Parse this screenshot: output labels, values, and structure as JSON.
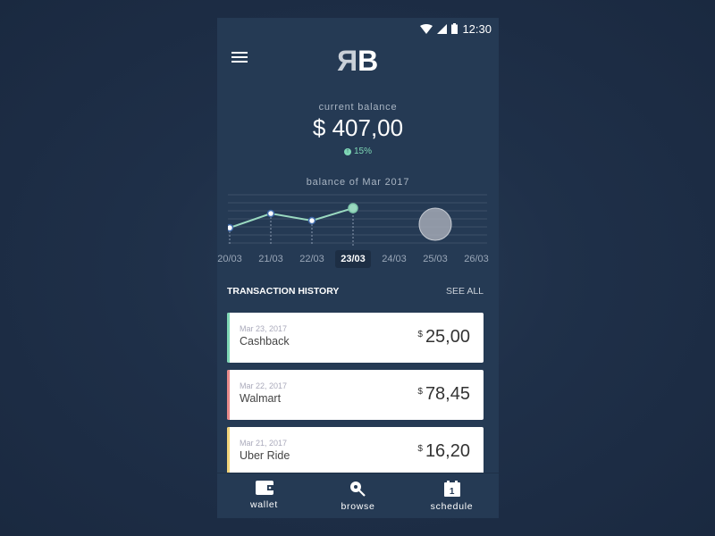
{
  "status_bar": {
    "time": "12:30",
    "icons": [
      "wifi-icon",
      "signal-icon",
      "battery-icon"
    ]
  },
  "header": {
    "logo_left": "R",
    "logo_right": "B",
    "menu_icon": "hamburger-menu-icon"
  },
  "balance": {
    "label": "current balance",
    "value": "$ 407,00",
    "change": "15%",
    "change_direction": "up"
  },
  "chart_data": {
    "type": "line",
    "title": "balance of Mar 2017",
    "categories": [
      "20/03",
      "21/03",
      "22/03",
      "23/03",
      "24/03",
      "25/03",
      "26/03"
    ],
    "values": [
      2,
      3.6,
      2.8,
      4.2,
      null,
      null,
      null
    ],
    "selected": "23/03",
    "gridlines": 7,
    "ylim": [
      0,
      6
    ],
    "highlight_circle_at": "25/03"
  },
  "transactions": {
    "title": "TRANSACTION HISTORY",
    "see_all": "SEE ALL",
    "items": [
      {
        "date": "Mar 23, 2017",
        "name": "Cashback",
        "currency": "$",
        "amount": "25,00",
        "color": "#7ed7b5"
      },
      {
        "date": "Mar 22, 2017",
        "name": "Walmart",
        "currency": "$",
        "amount": "78,45",
        "color": "#e88a8a"
      },
      {
        "date": "Mar 21, 2017",
        "name": "Uber Ride",
        "currency": "$",
        "amount": "16,20",
        "color": "#f2d47a"
      }
    ]
  },
  "nav": [
    {
      "label": "wallet",
      "icon": "wallet-icon"
    },
    {
      "label": "browse",
      "icon": "search-icon"
    },
    {
      "label": "schedule",
      "icon": "calendar-icon",
      "badge": "1"
    }
  ]
}
